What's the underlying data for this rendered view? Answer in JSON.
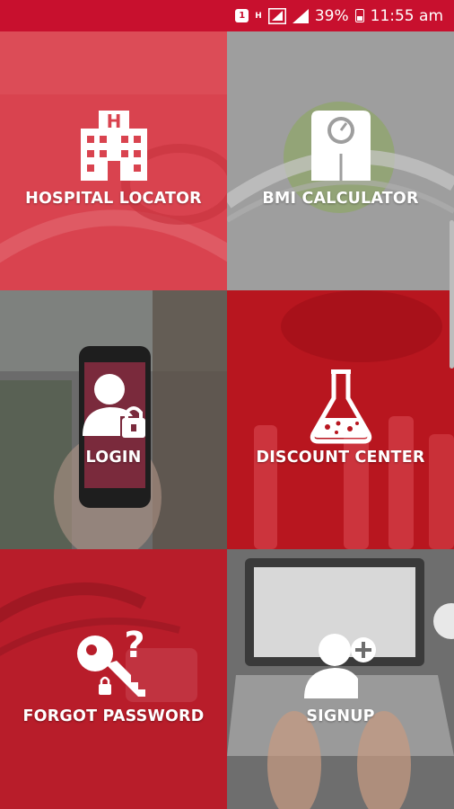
{
  "status_bar": {
    "notification_badge": "1",
    "network_type": "H",
    "battery_percent": "39%",
    "time": "11:55 am",
    "icons": [
      "notification-icon",
      "network-h-icon",
      "sim-signal-icon",
      "signal-icon",
      "battery-icon"
    ]
  },
  "tiles": [
    {
      "label": "HOSPITAL LOCATOR",
      "icon": "hospital-icon",
      "color": "#d9434f"
    },
    {
      "label": "BMI CALCULATOR",
      "icon": "scale-icon",
      "color": "#9e9e9e"
    },
    {
      "label": "LOGIN",
      "icon": "user-lock-icon",
      "color": "#6b6b6b"
    },
    {
      "label": "DISCOUNT CENTER",
      "icon": "flask-icon",
      "color": "#b8161f"
    },
    {
      "label": "FORGOT PASSWORD",
      "icon": "key-question-icon",
      "color": "#b81d2a"
    },
    {
      "label": "SIGNUP",
      "icon": "add-user-icon",
      "color": "#6e6e6e"
    }
  ]
}
